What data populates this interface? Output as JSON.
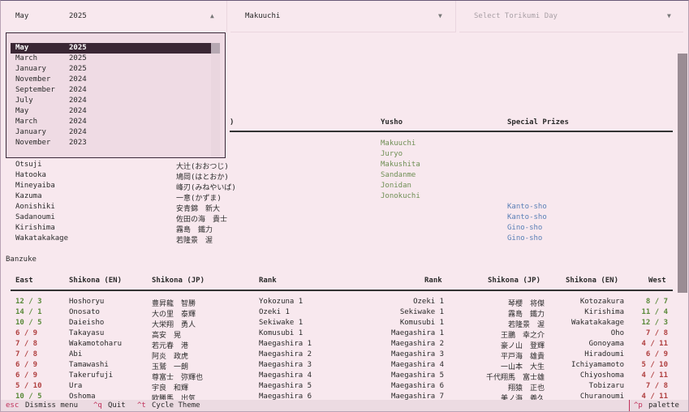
{
  "selectors": {
    "basho_month": "May",
    "basho_year": "2025",
    "division": "Makuuchi",
    "torikumi_placeholder": "Select Torikumi Day"
  },
  "dropdown_items": [
    {
      "month": "May",
      "year": "2025"
    },
    {
      "month": "March",
      "year": "2025"
    },
    {
      "month": "January",
      "year": "2025"
    },
    {
      "month": "November",
      "year": "2024"
    },
    {
      "month": "September",
      "year": "2024"
    },
    {
      "month": "July",
      "year": "2024"
    },
    {
      "month": "May",
      "year": "2024"
    },
    {
      "month": "March",
      "year": "2024"
    },
    {
      "month": "January",
      "year": "2024"
    },
    {
      "month": "November",
      "year": "2023"
    }
  ],
  "winners": {
    "partial_header": ")",
    "yusho_header": "Yusho",
    "prizes_header": "Special Prizes",
    "yusho_divisions": [
      "Makuuchi",
      "Juryo",
      "Makushita",
      "Sandanme",
      "Jonidan",
      "Jonokuchi"
    ],
    "rows": [
      {
        "en": "Otsuji",
        "jp": "大辻(おおつじ)",
        "prize": ""
      },
      {
        "en": "Hatooka",
        "jp": "鳩岡(はとおか)",
        "prize": ""
      },
      {
        "en": "Mineyaiba",
        "jp": "峰刃(みねやいば)",
        "prize": ""
      },
      {
        "en": "Kazuma",
        "jp": "一意(かずま)",
        "prize": ""
      },
      {
        "en": "Aonishiki",
        "jp": "安青錦　新大",
        "prize": "Kanto-sho"
      },
      {
        "en": "Sadanoumi",
        "jp": "佐田の海　貴士",
        "prize": "Kanto-sho"
      },
      {
        "en": "Kirishima",
        "jp": "霧島　鐵力",
        "prize": "Gino-sho"
      },
      {
        "en": "Wakatakakage",
        "jp": "若隆景　渥",
        "prize": "Gino-sho"
      }
    ]
  },
  "banzuke": {
    "title": "Banzuke",
    "headers": {
      "east": "East",
      "shikona_en": "Shikona (EN)",
      "shikona_jp": "Shikona (JP)",
      "rank": "Rank",
      "rank_w": "Rank",
      "shikona_jp_w": "Shikona (JP)",
      "shikona_en_w": "Shikona (EN)",
      "west": "West"
    },
    "rows": [
      {
        "er": "12 / 3",
        "eg": true,
        "een": "Hoshoryu",
        "ejp": "豊昇龍　智勝",
        "erank": "Yokozuna 1",
        "wrank": "Ozeki 1",
        "wjp": "琴櫻　将傑",
        "wen": "Kotozakura",
        "wr": "8 / 7",
        "wg": true
      },
      {
        "er": "14 / 1",
        "eg": true,
        "een": "Onosato",
        "ejp": "大の里　泰輝",
        "erank": "Ozeki 1",
        "wrank": "Sekiwake 1",
        "wjp": "霧島　鐵力",
        "wen": "Kirishima",
        "wr": "11 / 4",
        "wg": true
      },
      {
        "er": "10 / 5",
        "eg": true,
        "een": "Daieisho",
        "ejp": "大栄翔　勇人",
        "erank": "Sekiwake 1",
        "wrank": "Komusubi 1",
        "wjp": "若隆景　渥",
        "wen": "Wakatakakage",
        "wr": "12 / 3",
        "wg": true
      },
      {
        "er": "6 / 9",
        "eg": false,
        "een": "Takayasu",
        "ejp": "高安　晃",
        "erank": "Komusubi 1",
        "wrank": "Maegashira 1",
        "wjp": "王鵬　幸之介",
        "wen": "Oho",
        "wr": "7 / 8",
        "wg": false
      },
      {
        "er": "7 / 8",
        "eg": false,
        "een": "Wakamotoharu",
        "ejp": "若元春　港",
        "erank": "Maegashira 1",
        "wrank": "Maegashira 2",
        "wjp": "豪ノ山　登輝",
        "wen": "Gonoyama",
        "wr": "4 / 11",
        "wg": false
      },
      {
        "er": "7 / 8",
        "eg": false,
        "een": "Abi",
        "ejp": "阿炎　政虎",
        "erank": "Maegashira 2",
        "wrank": "Maegashira 3",
        "wjp": "平戸海　雄貴",
        "wen": "Hiradoumi",
        "wr": "6 / 9",
        "wg": false
      },
      {
        "er": "6 / 9",
        "eg": false,
        "een": "Tamawashi",
        "ejp": "玉鷲　一朗",
        "erank": "Maegashira 3",
        "wrank": "Maegashira 4",
        "wjp": "一山本　大生",
        "wen": "Ichiyamamoto",
        "wr": "5 / 10",
        "wg": false
      },
      {
        "er": "6 / 9",
        "eg": false,
        "een": "Takerufuji",
        "ejp": "尊富士　弥輝也",
        "erank": "Maegashira 4",
        "wrank": "Maegashira 5",
        "wjp": "千代翔馬　富士雄",
        "wen": "Chiyoshoma",
        "wr": "4 / 11",
        "wg": false
      },
      {
        "er": "5 / 10",
        "eg": false,
        "een": "Ura",
        "ejp": "宇良　和輝",
        "erank": "Maegashira 5",
        "wrank": "Maegashira 6",
        "wjp": "翔猿　正也",
        "wen": "Tobizaru",
        "wr": "7 / 8",
        "wg": false
      },
      {
        "er": "10 / 5",
        "eg": true,
        "een": "Oshoma",
        "ejp": "欧勝馬　出気",
        "erank": "Maegashira 6",
        "wrank": "Maegashira 7",
        "wjp": "美ノ海　義久",
        "wen": "Churanoumi",
        "wr": "4 / 11",
        "wg": false
      }
    ]
  },
  "footer": {
    "esc_key": "esc",
    "esc_label": "Dismiss menu",
    "quit_key": "^q",
    "quit_label": "Quit",
    "theme_key": "^t",
    "theme_label": "Cycle Theme",
    "palette_key": "^p",
    "palette_label": "palette"
  },
  "colors": {
    "win_record": "#5a8a3a",
    "loss_record": "#b04040",
    "yusho": "#6f8f55",
    "prize": "#5a7fb6",
    "highlight": "#3a2734"
  },
  "icons": {
    "dropdown_open": "triangle-up-icon",
    "dropdown_closed": "triangle-down-icon"
  }
}
